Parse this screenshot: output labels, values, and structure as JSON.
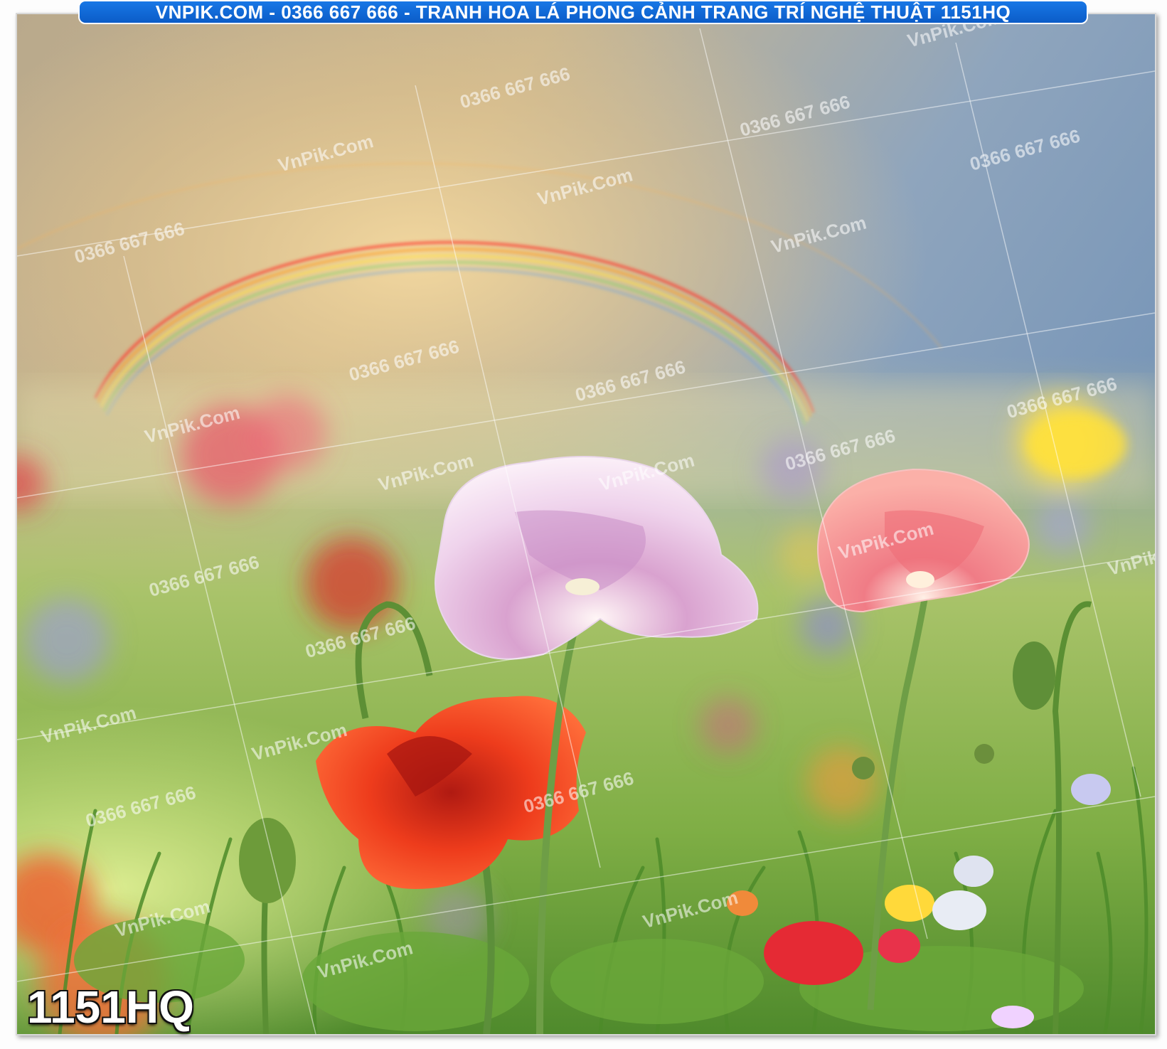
{
  "banner": {
    "text": "VNPIK.COM - 0366 667 666 - TRANH HOA LÁ PHONG CẢNH TRANG TRÍ NGHỆ THUẬT 1151HQ"
  },
  "product_code": "1151HQ",
  "watermark": {
    "site": "VnPik.Com",
    "phone": "0366 667 666"
  },
  "image": {
    "subject": "poppies-meadow-rainbow",
    "colors": {
      "banner_bg": "#0b5cc8",
      "sky": "#8aa6c4",
      "glow": "#e6c98a",
      "meadow": "#9cc35a"
    }
  }
}
